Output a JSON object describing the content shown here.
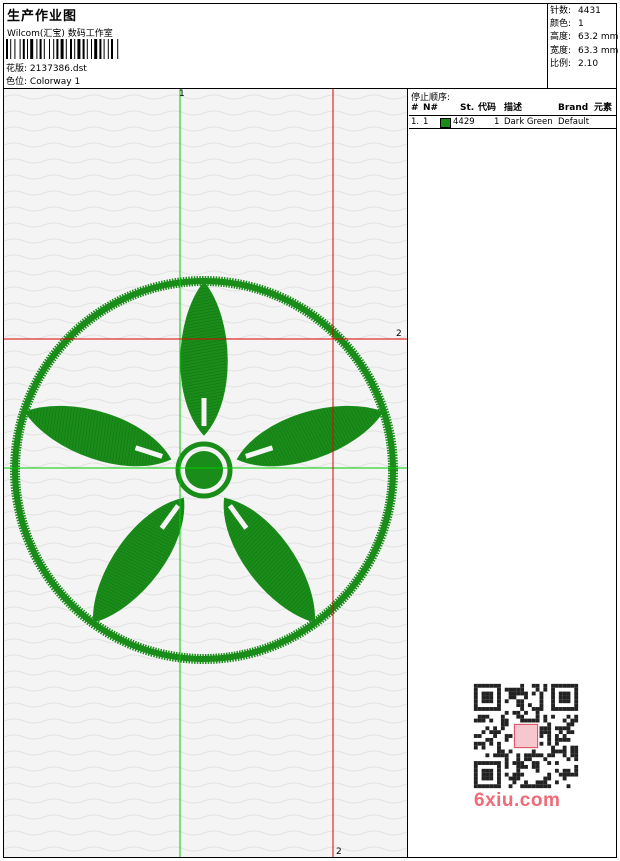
{
  "header": {
    "title": "生产作业图",
    "company": "Wilcom(汇宝) 数码工作室",
    "design_label": "花版:",
    "design_file": "2137386.dst",
    "colorway_label": "色位:",
    "colorway": "Colorway 1"
  },
  "stats": {
    "stitches_label": "针数:",
    "stitches": "4431",
    "colors_label": "颜色:",
    "colors": "1",
    "height_label": "高度:",
    "height": "63.2 mm",
    "width_label": "宽度:",
    "width": "63.3 mm",
    "ratio_label": "比例:",
    "ratio": "2.10"
  },
  "stop_sequence": {
    "title": "停止顺序:",
    "headers": {
      "hash": "#",
      "no": "N#",
      "st": "St.",
      "code": "代码",
      "desc": "描述",
      "brand": "Brand",
      "element": "元素"
    },
    "rows": [
      {
        "index": "1.",
        "no": "1",
        "swatch_color": "#1a8c1a",
        "stitches": "4429",
        "code": "1",
        "description": "Dark Green",
        "brand": "Default"
      }
    ]
  },
  "guides": {
    "green_label": "1",
    "red_label_right": "2",
    "red_label_bottom": "2",
    "green_color": "#00cc00",
    "red_color": "#dd0000"
  },
  "design": {
    "thread_color": "#1a8c1a"
  },
  "watermark": {
    "text": "6xiu.com"
  }
}
